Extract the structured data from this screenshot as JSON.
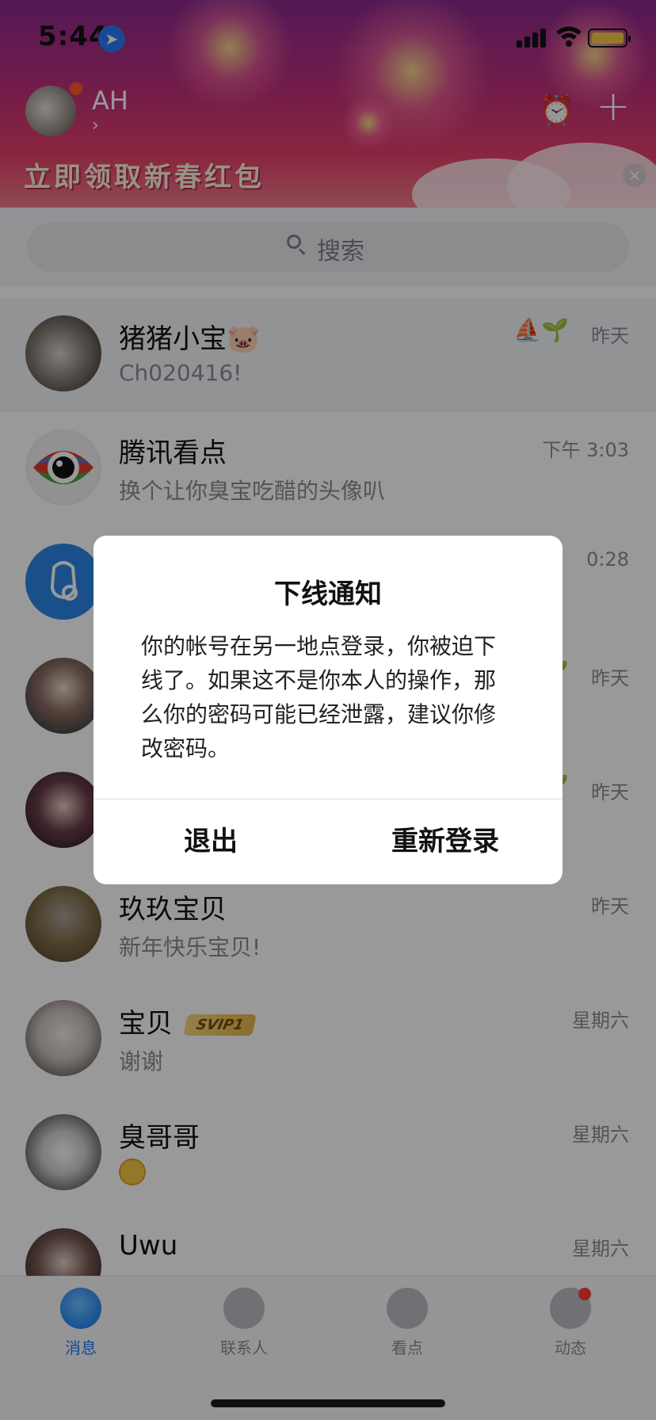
{
  "status_bar": {
    "time": "5:44"
  },
  "header": {
    "user_name": "AH",
    "chevron": "›",
    "banner_text": "立即领取新春红包",
    "plus_symbol": "+",
    "close_symbol": "×"
  },
  "search": {
    "placeholder": "搜索"
  },
  "conversations": [
    {
      "name": "猪猪小宝🐷",
      "message": "Ch020416!",
      "time": "昨天",
      "tags": "⛵🌱"
    },
    {
      "name": "腾讯看点",
      "message": "换个让你臭宝吃醋的头像叭",
      "time": "下午 3:03"
    },
    {
      "name": "",
      "message": "",
      "time": "0:28"
    },
    {
      "name": "",
      "message": "",
      "time": "昨天",
      "tags": "🌱"
    },
    {
      "name": "",
      "message": "",
      "time": "昨天",
      "tags": "🌱"
    },
    {
      "name": "玖玖宝贝",
      "message": "新年快乐宝贝!",
      "time": "昨天"
    },
    {
      "name": "宝贝",
      "message": "谢谢",
      "time": "星期六",
      "badge": "SVIP1"
    },
    {
      "name": "臭哥哥",
      "message": "",
      "time": "星期六"
    },
    {
      "name": "Uwu",
      "message": "",
      "time": "星期六"
    }
  ],
  "dialog": {
    "title": "下线通知",
    "body": "你的帐号在另一地点登录，你被迫下线了。如果这不是你本人的操作，那么你的密码可能已经泄露，建议你修改密码。",
    "exit_label": "退出",
    "relogin_label": "重新登录"
  },
  "tabs": [
    {
      "label": "消息",
      "icon": "chat-bubble-icon",
      "active": true
    },
    {
      "label": "联系人",
      "icon": "contacts-icon"
    },
    {
      "label": "看点",
      "icon": "eye-icon"
    },
    {
      "label": "动态",
      "icon": "planet-icon"
    }
  ],
  "colors": {
    "accent": "#1f7ef5",
    "banner_top": "#8a2a8e",
    "banner_bottom": "#f07c8a",
    "badge": "#ff3b30"
  }
}
